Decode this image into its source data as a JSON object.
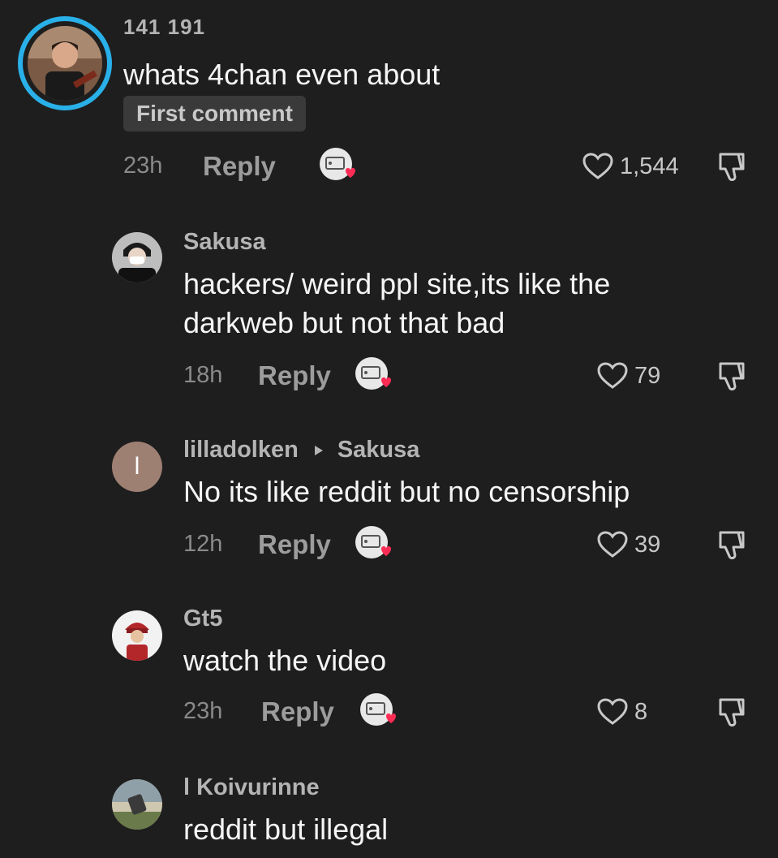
{
  "comments": [
    {
      "username": "141 191",
      "text": "whats 4chan even about",
      "badge": "First comment",
      "time": "23h",
      "reply_label": "Reply",
      "likes": "1,544"
    },
    {
      "username": "Sakusa",
      "text_lines": [
        "hackers/ weird ppl site,its like the",
        "darkweb but not that bad"
      ],
      "time": "18h",
      "reply_label": "Reply",
      "likes": "79"
    },
    {
      "username": "lilladolken",
      "reply_to": "Sakusa",
      "avatar_initial": "l",
      "text": "No its like reddit but no censorship",
      "time": "12h",
      "reply_label": "Reply",
      "likes": "39"
    },
    {
      "username": "Gt5",
      "text": "watch the video",
      "time": "23h",
      "reply_label": "Reply",
      "likes": "8"
    },
    {
      "username": "l Koivurinne",
      "text": "reddit but illegal"
    }
  ],
  "colors": {
    "background": "#1e1e1e",
    "avatar_ring": "#2ab0e8",
    "heart_badge": "#fe2c55",
    "badge_bg": "#3a3a3a"
  },
  "icons": [
    "heart-outline-icon",
    "dislike-icon",
    "creator-liked-icon",
    "reply-to-arrow-icon"
  ]
}
